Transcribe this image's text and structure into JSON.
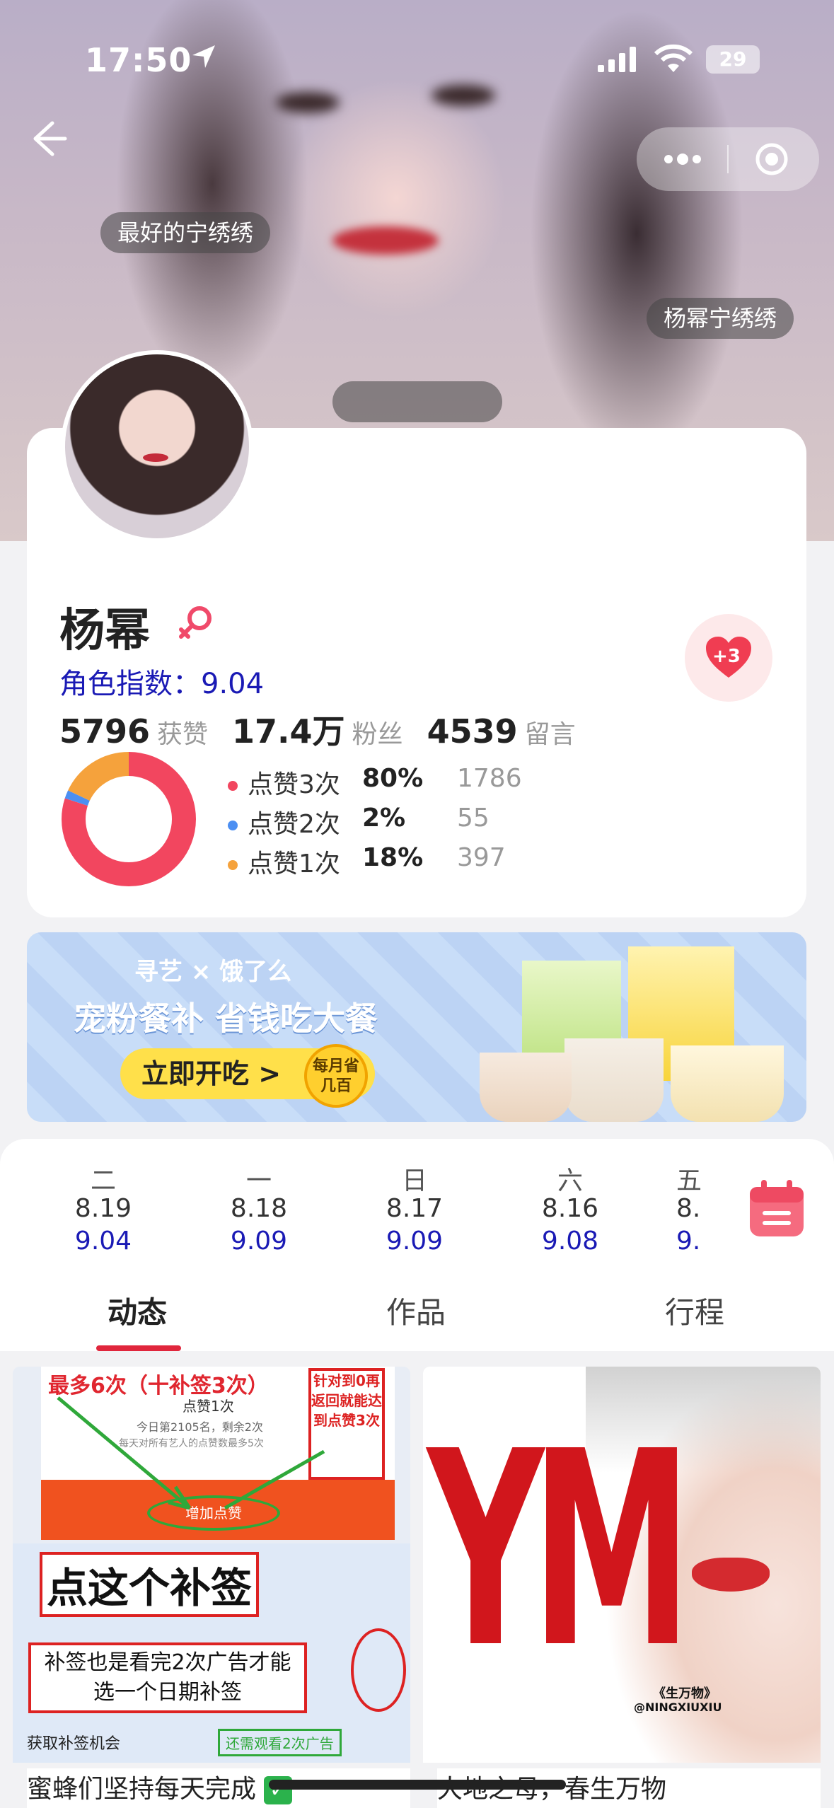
{
  "status_bar": {
    "time": "17:50",
    "battery": "29"
  },
  "hero": {
    "bubbles": [
      "最好的宁绣绣",
      "杨幂宁绣绣",
      ""
    ]
  },
  "profile": {
    "name": "杨幂",
    "index_label": "角色指数：",
    "index_value": "9.04",
    "like_badge": "+3",
    "stats": [
      {
        "value": "5796",
        "label": "获赞"
      },
      {
        "value": "17.4万",
        "label": "粉丝"
      },
      {
        "value": "4539",
        "label": "留言"
      }
    ],
    "breakdown": [
      {
        "label": "点赞3次",
        "percent": "80%",
        "count": "1786",
        "color": "#f2465f"
      },
      {
        "label": "点赞2次",
        "percent": "2%",
        "count": "55",
        "color": "#4c8ff2"
      },
      {
        "label": "点赞1次",
        "percent": "18%",
        "count": "397",
        "color": "#f5a23c"
      }
    ]
  },
  "banner": {
    "brand": "寻艺 × 饿了么",
    "title": "宠粉餐补 省钱吃大餐",
    "cta": "立即开吃 >",
    "seal": "每月省几百"
  },
  "dates": [
    {
      "weekday": "二",
      "date": "8.19",
      "index": "9.04"
    },
    {
      "weekday": "一",
      "date": "8.18",
      "index": "9.09"
    },
    {
      "weekday": "日",
      "date": "8.17",
      "index": "9.09"
    },
    {
      "weekday": "六",
      "date": "8.16",
      "index": "9.08"
    },
    {
      "weekday": "五",
      "date": "8.",
      "index": "9."
    }
  ],
  "tabs": [
    "动态",
    "作品",
    "行程"
  ],
  "feed": [
    {
      "caption": "蜜蜂们坚持每天完成",
      "screenshot": {
        "top_text": "最多6次（十补签3次）",
        "like_once": "点赞1次",
        "rank_text": "今日第2105名，剩余2次",
        "rule_text": "每天对所有艺人的点赞数最多5次",
        "button": "增加点赞",
        "side_note": "针对到0再返回就能达到点赞3次",
        "big_note": "点这个补签",
        "note2": "补签也是看完2次广告才能选一个日期补签",
        "bottom_left": "获取补签机会",
        "bottom_right": "还需观看2次广告"
      }
    },
    {
      "caption": "大地之母，春生万物",
      "poster": {
        "big": "YM",
        "title": "《生万物》",
        "handle": "@NINGXIUXIU"
      }
    }
  ]
}
